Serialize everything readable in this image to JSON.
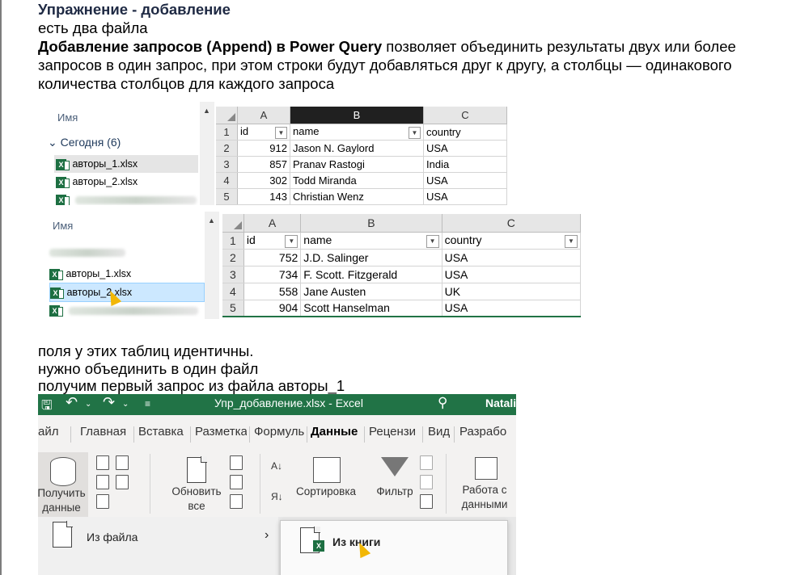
{
  "heading": "Упражнение - добавление",
  "line_two_files": "есть два файла",
  "intro_bold": "Добавление запросов (Append) в Power Query",
  "intro_rest": " позволяет объединить результаты двух или более запросов в один запрос, при этом строки будут добавляться друг к другу, а столбцы — одинакового количества столбцов для каждого запроса",
  "explorer1": {
    "header": "Имя",
    "group": "Сегодня (6)",
    "files": [
      "авторы_1.xlsx",
      "авторы_2.xlsx"
    ]
  },
  "sheet1": {
    "columns": [
      "A",
      "B",
      "C"
    ],
    "header_row": [
      "id",
      "name",
      "country"
    ],
    "rows": [
      {
        "n": "2",
        "id": "912",
        "name": "Jason N. Gaylord",
        "country": "USA"
      },
      {
        "n": "3",
        "id": "857",
        "name": "Pranav Rastogi",
        "country": "India"
      },
      {
        "n": "4",
        "id": "302",
        "name": "Todd Miranda",
        "country": "USA"
      },
      {
        "n": "5",
        "id": "143",
        "name": "Christian Wenz",
        "country": "USA"
      }
    ]
  },
  "explorer2": {
    "header": "Имя",
    "files": [
      "авторы_1.xlsx",
      "авторы_2.xlsx"
    ]
  },
  "sheet2": {
    "columns": [
      "A",
      "B",
      "C"
    ],
    "header_row": [
      "id",
      "name",
      "country"
    ],
    "rows": [
      {
        "n": "2",
        "id": "752",
        "name": "J.D. Salinger",
        "country": "USA"
      },
      {
        "n": "3",
        "id": "734",
        "name": "F. Scott. Fitzgerald",
        "country": "USA"
      },
      {
        "n": "4",
        "id": "558",
        "name": "Jane Austen",
        "country": "UK"
      },
      {
        "n": "5",
        "id": "904",
        "name": "Scott Hanselman",
        "country": "USA"
      }
    ]
  },
  "line_fields": "поля у этих таблиц идентичны.",
  "line_merge": "нужно объединить в один файл",
  "line_first_query": "получим первый запрос из файла авторы_1",
  "excel": {
    "window_title": "Упр_добавление.xlsx  -  Excel",
    "user": "Natali",
    "tabs": [
      "айл",
      "Главная",
      "Вставка",
      "Разметка",
      "Формулы",
      "Данные",
      "Рецензи",
      "Вид",
      "Разрабо"
    ],
    "active_tab": "Данные",
    "get_data_label_1": "Получить",
    "get_data_label_2": "данные",
    "refresh_label_1": "Обновить",
    "refresh_label_2": "все",
    "sort_label": "Сортировка",
    "filter_label": "Фильтр",
    "data_tools_label_1": "Работа с",
    "data_tools_label_2": "данными",
    "menu_from_file": "Из файла",
    "menu_from_workbook": "Из книги"
  },
  "colors": {
    "excel_green": "#217346",
    "heading": "#1f2a44",
    "selection_blue": "#cce8ff"
  }
}
